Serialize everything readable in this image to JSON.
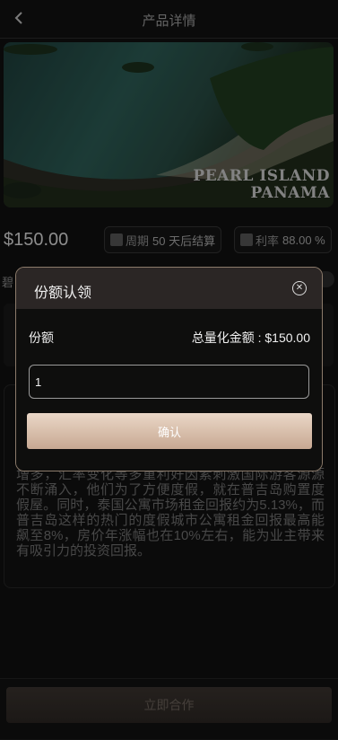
{
  "header": {
    "title": "产品详情",
    "back_icon": "chevron-left-icon"
  },
  "hero": {
    "line1": "PEARL ISLAND",
    "line2": "PANAMA"
  },
  "product": {
    "price": "$150.00",
    "period_label": "周期",
    "period_value": "50 天后结算",
    "rate_label": "利率",
    "rate_value": "88.00 %"
  },
  "side_label": "碧",
  "description": "增多，汇率变化等多重利好因素刺激国际游客源源不断涌入，他们为了方便度假，就在普吉岛购置度假屋。同时，泰国公寓市场租金回报约为5.13%，而普吉岛这样的热门的度假城市公寓租金回报最高能飙至8%，房价年涨幅也在10%左右，能为业主带来有吸引力的投资回报。",
  "bottom": {
    "cta": "立即合作"
  },
  "modal": {
    "title": "份额认领",
    "share_label": "份额",
    "total_label": "总量化金额",
    "total_value": ": $150.00",
    "input_value": "1",
    "confirm": "确认",
    "accent": "#c7a892"
  }
}
